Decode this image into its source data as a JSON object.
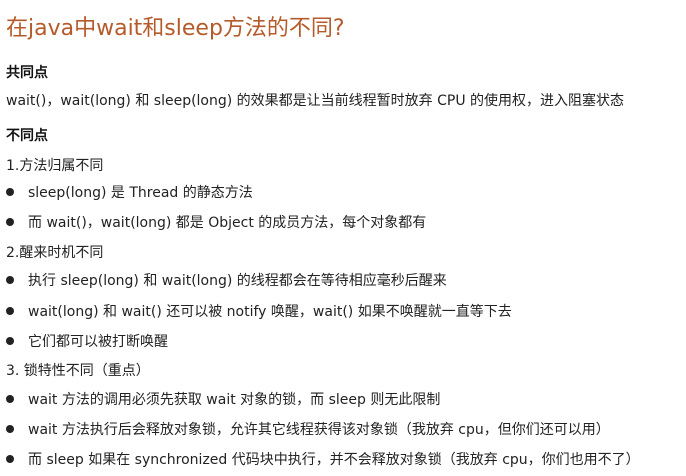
{
  "doc": {
    "title": "在java中wait和sleep方法的不同?",
    "common_heading": "共同点",
    "common_text": "wait()，wait(long) 和 sleep(long) 的效果都是让当前线程暂时放弃 CPU 的使用权，进入阻塞状态",
    "diff_heading": "不同点",
    "sections": [
      {
        "title": "1.方法归属不同",
        "bullets": [
          "sleep(long) 是 Thread 的静态方法",
          "而 wait()，wait(long) 都是 Object 的成员方法，每个对象都有"
        ]
      },
      {
        "title": "2.醒来时机不同",
        "bullets": [
          "执行 sleep(long) 和 wait(long) 的线程都会在等待相应毫秒后醒来",
          "wait(long) 和 wait() 还可以被 notify 唤醒，wait() 如果不唤醒就一直等下去",
          "它们都可以被打断唤醒"
        ]
      },
      {
        "title": "3. 锁特性不同（重点）",
        "bullets": [
          "wait 方法的调用必须先获取 wait 对象的锁，而 sleep 则无此限制",
          "wait 方法执行后会释放对象锁，允许其它线程获得该对象锁（我放弃 cpu，但你们还可以用）",
          "而 sleep 如果在 synchronized 代码块中执行，并不会释放对象锁（我放弃 cpu，你们也用不了）"
        ]
      }
    ]
  }
}
